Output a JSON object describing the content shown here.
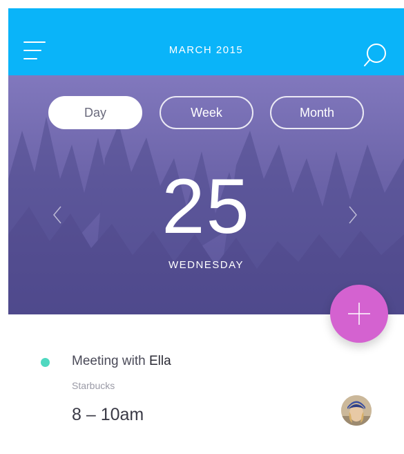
{
  "header": {
    "title": "MARCH 2015",
    "background_color": "#0ab4f9",
    "menu_icon": "hamburger-menu-icon",
    "search_icon": "search-icon"
  },
  "view_switcher": {
    "options": [
      "Day",
      "Week",
      "Month"
    ],
    "selected": "Day"
  },
  "date_display": {
    "day_number": "25",
    "weekday": "WEDNESDAY",
    "prev_icon": "chevron-left-icon",
    "next_icon": "chevron-right-icon"
  },
  "fab": {
    "icon": "plus-icon",
    "color": "#d462d0"
  },
  "events": [
    {
      "title_prefix": "Meeting with ",
      "title_name": "Ella",
      "location": "Starbucks",
      "time": "8 – 10am",
      "dot_color": "#4fd8c0"
    }
  ]
}
